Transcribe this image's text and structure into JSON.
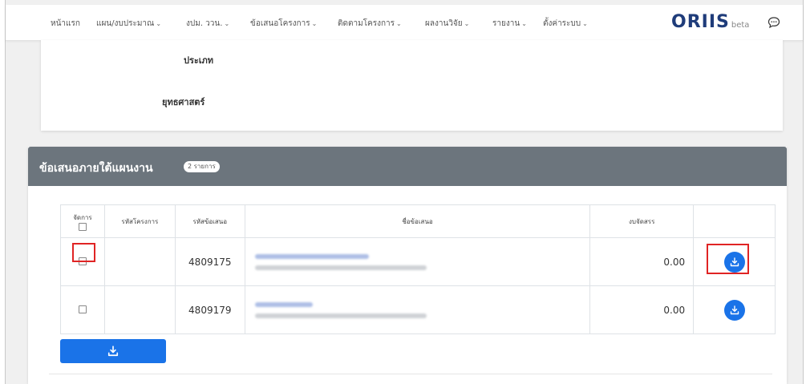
{
  "nav": {
    "items": [
      {
        "label": "หน้าแรก",
        "has_menu": false
      },
      {
        "label": "แผน/งบประมาณ",
        "has_menu": true
      },
      {
        "label": "งปม. ววน.",
        "has_menu": true
      },
      {
        "label": "ข้อเสนอโครงการ",
        "has_menu": true
      },
      {
        "label": "ติดตามโครงการ",
        "has_menu": true
      },
      {
        "label": "ผลงานวิจัย",
        "has_menu": true
      },
      {
        "label": "รายงาน",
        "has_menu": true
      },
      {
        "label": "ตั้งค่าระบบ",
        "has_menu": true
      }
    ],
    "chevron": "⌄",
    "brand": {
      "text_a": "ORI",
      "text_b": "IS",
      "suffix": "beta"
    },
    "chat_icon": "chat-bubble-icon"
  },
  "info": {
    "type_label": "ประเภท",
    "strategy_label": "ยุทธศาสตร์"
  },
  "proposals": {
    "title": "ข้อเสนอภายใต้แผนงาน",
    "count_badge": "2 รายการ",
    "columns": {
      "action": "จัดการ",
      "project_code": "รหัสโครงการ",
      "proposal_code": "รหัสข้อเสนอ",
      "proposal_name": "ชื่อข้อเสนอ",
      "budget": "งบจัดสรร"
    },
    "rows": [
      {
        "project_code": "",
        "proposal_code": "4809175",
        "budget": "0.00",
        "checked": false,
        "highlighted": true
      },
      {
        "project_code": "",
        "proposal_code": "4809179",
        "budget": "0.00",
        "checked": false,
        "highlighted": false
      }
    ],
    "download_icon": "download-icon"
  },
  "colors": {
    "header_bg": "#6c757d",
    "primary": "#1a73e8",
    "highlight": "#e02424",
    "brand": "#1f3c7a"
  }
}
